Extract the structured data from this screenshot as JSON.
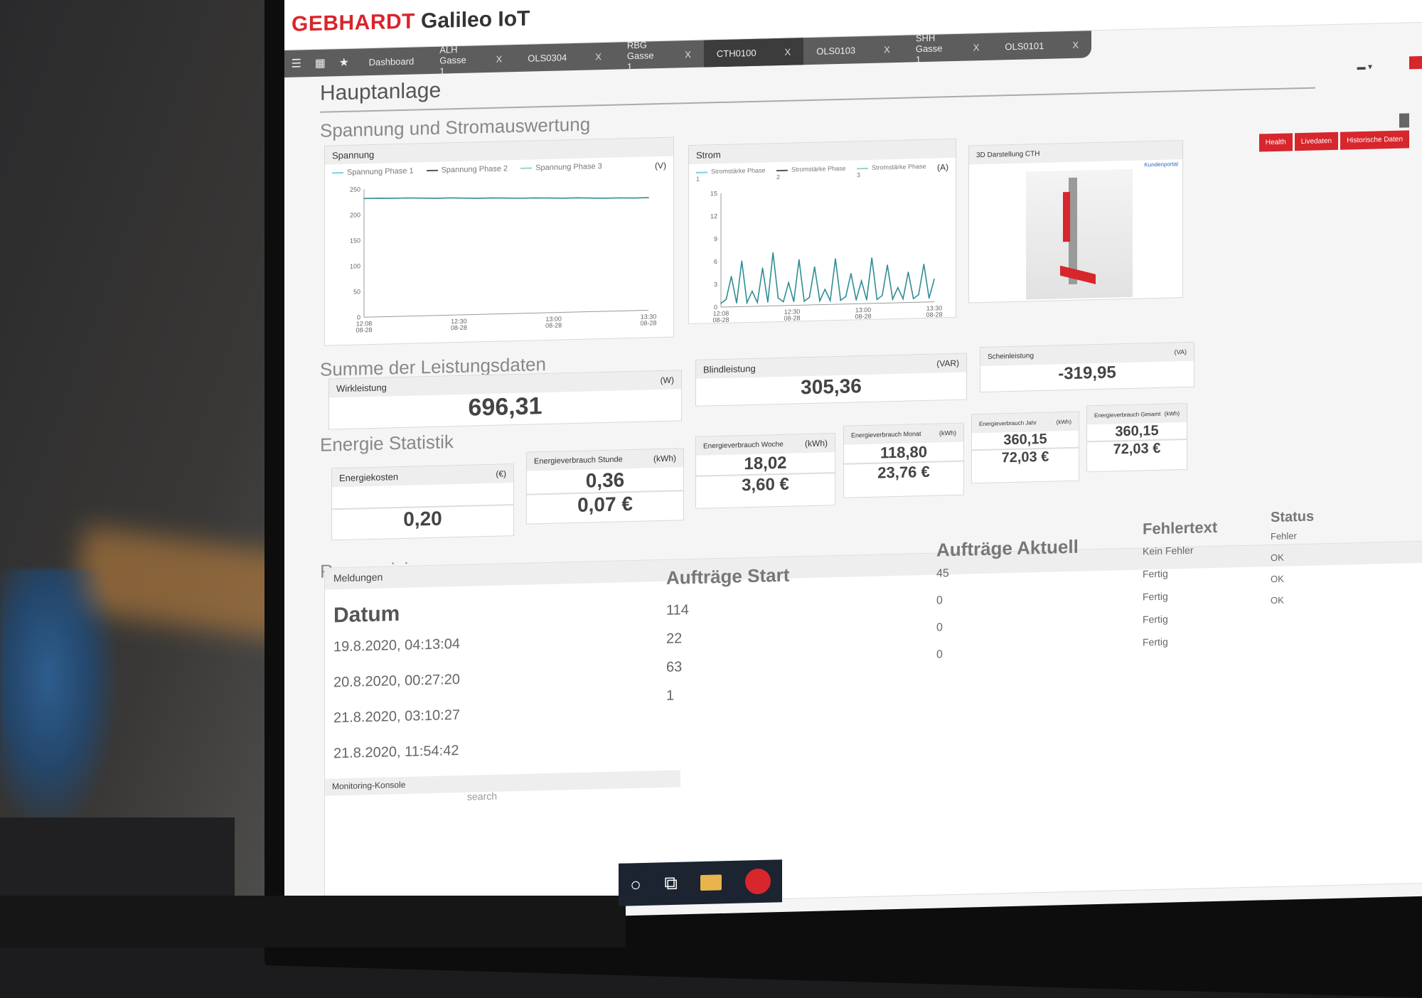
{
  "app": {
    "brand_a": "GEBHARDT",
    "brand_b": "Galileo IoT"
  },
  "tabs": [
    {
      "label": "Dashboard",
      "closable": false
    },
    {
      "label": "ALH Gasse 1",
      "closable": true
    },
    {
      "label": "OLS0304",
      "closable": true
    },
    {
      "label": "RBG Gasse 1",
      "closable": true
    },
    {
      "label": "CTH0100",
      "closable": true,
      "active": true
    },
    {
      "label": "OLS0103",
      "closable": true
    },
    {
      "label": "SHH Gasse 1",
      "closable": true
    },
    {
      "label": "OLS0101",
      "closable": true
    }
  ],
  "close_glyph": "X",
  "page_title": "Hauptanlage",
  "section_power": "Spannung und Stromauswertung",
  "buttons": {
    "health": "Health",
    "live": "Livedaten",
    "history": "Historische Daten"
  },
  "voltage_card": {
    "title": "Spannung",
    "unit": "(V)",
    "legend": [
      "Spannung Phase 1",
      "Spannung Phase 2",
      "Spannung Phase 3"
    ]
  },
  "current_card": {
    "title": "Strom",
    "unit": "(A)",
    "legend": [
      "Stromstärke Phase 1",
      "Stromstärke Phase 2",
      "Stromstärke Phase 3"
    ]
  },
  "model_card": {
    "title": "3D Darstellung CTH",
    "link": "Kundenportal"
  },
  "section_sum": "Summe der Leistungsdaten",
  "sum": {
    "wirk": {
      "label": "Wirkleistung",
      "unit": "(W)",
      "value": "696,31"
    },
    "blind": {
      "label": "Blindleistung",
      "unit": "(VAR)",
      "value": "305,36"
    },
    "schein": {
      "label": "Scheinleistung",
      "unit": "(VA)",
      "value": "-319,95"
    }
  },
  "section_energy": "Energie Statistik",
  "energy": [
    {
      "label": "Energiekosten",
      "unit": "(€)",
      "v1": "",
      "v2": "0,20"
    },
    {
      "label": "Energieverbrauch Stunde",
      "unit": "(kWh)",
      "v1": "0,36",
      "v2": "0,07 €"
    },
    {
      "label": "Energieverbrauch Woche",
      "unit": "(kWh)",
      "v1": "18,02",
      "v2": "3,60 €"
    },
    {
      "label": "Energieverbrauch Monat",
      "unit": "(kWh)",
      "v1": "118,80",
      "v2": "23,76 €"
    },
    {
      "label": "Energieverbrauch Jahr",
      "unit": "(kWh)",
      "v1": "360,15",
      "v2": "72,03 €"
    },
    {
      "label": "Energieverbrauch Gesamt",
      "unit": "(kWh)",
      "v1": "360,15",
      "v2": "72,03 €"
    }
  ],
  "section_reorg": "Reorganisierung",
  "table": {
    "caption": "Meldungen",
    "headers": [
      "Datum",
      "Aufträge Start",
      "Aufträge Aktuell",
      "Fehlertext",
      "Status"
    ],
    "rows": [
      [
        "19.8.2020, 04:13:04",
        "114",
        "45",
        "Kein Fehler",
        "Fehler"
      ],
      [
        "20.8.2020, 00:27:20",
        "22",
        "0",
        "Fertig",
        "OK"
      ],
      [
        "21.8.2020, 03:10:27",
        "63",
        "0",
        "Fertig",
        "OK"
      ],
      [
        "21.8.2020, 11:54:42",
        "1",
        "0",
        "Fertig",
        "OK"
      ]
    ],
    "extra_fehler": "Fertig"
  },
  "footer": {
    "console": "Monitoring-Konsole",
    "search": "search"
  },
  "colors": {
    "brand_red": "#d7262c",
    "series": "#2f8c96",
    "tab_bg": "#5d5d5d"
  },
  "chart_data": [
    {
      "type": "line",
      "title": "Spannung",
      "ylabel": "(V)",
      "ylim": [
        0,
        250
      ],
      "yticks": [
        "250",
        "200",
        "150",
        "100",
        "50",
        "0"
      ],
      "xticks": [
        "12:08\n08-28",
        "12:30\n08-28",
        "13:00\n08-28",
        "13:30\n08-28"
      ],
      "series": [
        {
          "name": "Spannung Phase 1",
          "values": [
            232,
            232,
            231,
            231,
            230,
            229,
            229,
            228,
            227,
            227,
            226,
            225,
            225,
            224,
            223,
            223,
            222,
            221,
            221,
            220,
            220
          ]
        }
      ]
    },
    {
      "type": "line",
      "title": "Strom",
      "ylabel": "(A)",
      "ylim": [
        0,
        15
      ],
      "yticks": [
        "15",
        "12",
        "9",
        "6",
        "3",
        "0"
      ],
      "xticks": [
        "12:08\n08-28",
        "12:30\n08-28",
        "13:00\n08-28",
        "13:30\n08-28"
      ],
      "series": [
        {
          "name": "Stromstärke Phase 1",
          "values": [
            0.5,
            1,
            4,
            0.5,
            6,
            0.5,
            2,
            0.5,
            5,
            0.5,
            7,
            1,
            0.5,
            3,
            0.5,
            6,
            0.5,
            1,
            5,
            0.5,
            2,
            0.5,
            6,
            0.5,
            1,
            4,
            0.5,
            3,
            0.5,
            6,
            0.5,
            1,
            5,
            0.5,
            2,
            0.5,
            4,
            0.5,
            1,
            5,
            0.5,
            3
          ]
        }
      ]
    }
  ]
}
